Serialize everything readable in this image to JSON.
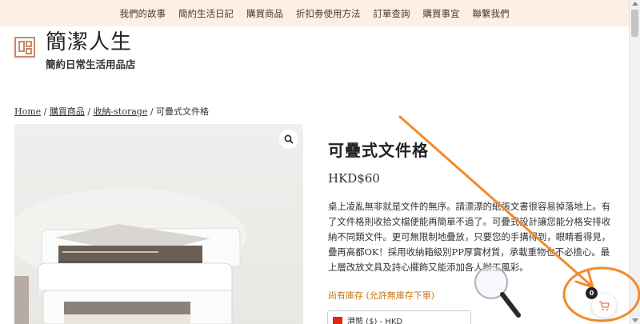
{
  "nav": {
    "items": [
      "我們的故事",
      "簡約生活日記",
      "購買商品",
      "折扣劵使用方法",
      "訂單查詢",
      "購買事宜",
      "聯繫我們"
    ]
  },
  "site": {
    "title": "簡潔人生",
    "tagline": "簡約日常生活用品店"
  },
  "breadcrumb": {
    "home": "Home",
    "sep": " / ",
    "shop": "購買商品",
    "category": "收納-storage",
    "current": "可疊式文件格"
  },
  "product": {
    "title": "可疊式文件格",
    "price": "HKD$60",
    "description": "桌上凌亂無非就是文件的無序。請漂漂的紙張文書很容易掉落地上。有了文件格則收拾文檔便能再簡單不過了。可疊式設計讓您能分格安排收納不同類文件。更可無限制地疊放，只要您的手搆得到，眼睛看得見，疊再高都OK！採用收納箱級別PP厚實材質，承載重物也不必擔心。最上層改放文具及詩心擺飾又能添加各人辦工風彩。",
    "stock": "尚有庫存 (允許無庫存下單)"
  },
  "currency": {
    "label": "港幣 ($) - HKD"
  },
  "cart": {
    "count": "0"
  },
  "icons": {
    "zoom": "magnifier-icon",
    "cart": "cart-icon",
    "logo": "logo-icon"
  },
  "colors": {
    "nav_bg": "#fbefe6",
    "accent": "#c9896a",
    "stock": "#c9761a",
    "annotation": "#f28a2c"
  }
}
